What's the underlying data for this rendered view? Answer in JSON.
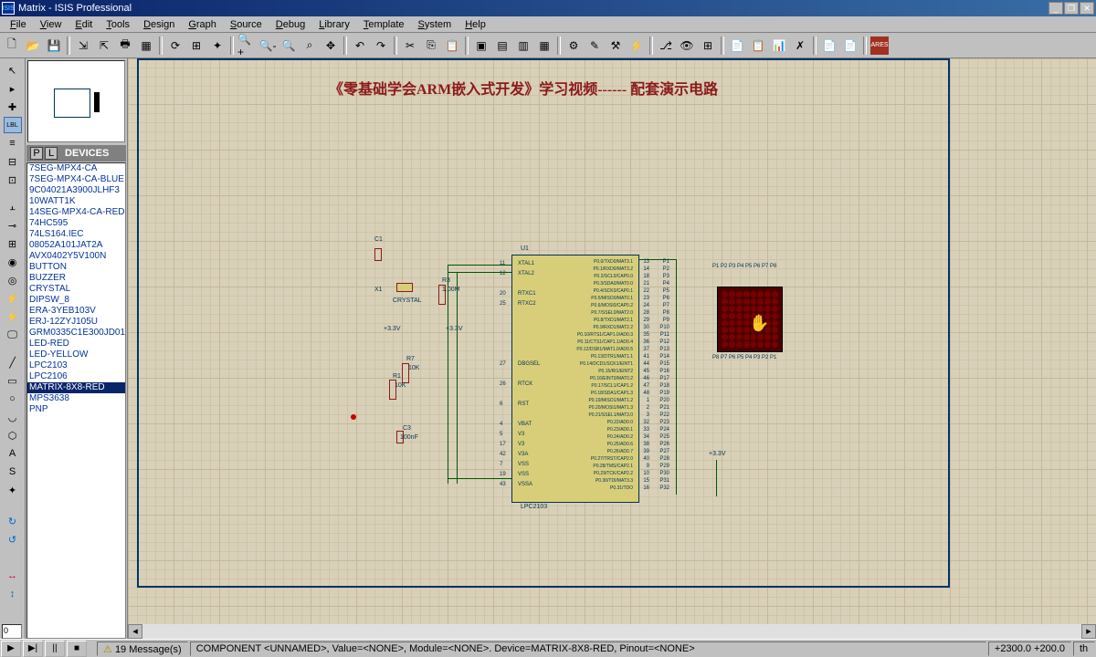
{
  "title": "Matrix - ISIS Professional",
  "menu": [
    "File",
    "View",
    "Edit",
    "Tools",
    "Design",
    "Graph",
    "Source",
    "Debug",
    "Library",
    "Template",
    "System",
    "Help"
  ],
  "heading": "《零基础学会ARM嵌入式开发》学习视频------ 配套演示电路",
  "devices_header": "DEVICES",
  "devices": [
    "7SEG-MPX4-CA",
    "7SEG-MPX4-CA-BLUE",
    "9C04021A3900JLHF3",
    "10WATT1K",
    "14SEG-MPX4-CA-RED",
    "74HC595",
    "74LS164.IEC",
    "08052A101JAT2A",
    "AVX0402Y5V100N",
    "BUTTON",
    "BUZZER",
    "CRYSTAL",
    "DIPSW_8",
    "ERA-3YEB103V",
    "ERJ-12ZYJ105U",
    "GRM0335C1E300JD01D",
    "LED-RED",
    "LED-YELLOW",
    "LPC2103",
    "LPC2106",
    "MATRIX-8X8-RED",
    "MPS3638",
    "PNP"
  ],
  "selected_device_index": 20,
  "ic_ref": "U1",
  "ic_part": "LPC2103",
  "left_pins": [
    "XTAL1",
    "XTAL2",
    "",
    "RTXC1",
    "RTXC2",
    "",
    "",
    "",
    "",
    "",
    "DBGSEL",
    "",
    "RTCK",
    "",
    "RST",
    "",
    "VBAT",
    "V3",
    "V3",
    "V3A",
    "VSS",
    "VSS",
    "VSSA"
  ],
  "left_pin_nums": [
    "11",
    "12",
    "",
    "20",
    "25",
    "",
    "",
    "",
    "",
    "",
    "27",
    "",
    "26",
    "",
    "6",
    "",
    "4",
    "5",
    "17",
    "42",
    "7",
    "19",
    "43"
  ],
  "right_pins": [
    "P0.0/TXD0/MAT3.1",
    "P0.1/RXD0/MAT3.2",
    "P0.2/SCL0/CAP0.0",
    "P0.3/SDA0/MAT0.0",
    "P0.4/SCK0/CAP0.1",
    "P0.5/MISO0/MAT0.1",
    "P0.6/MOSI0/CAP0.2",
    "P0.7/SSEL0/MAT2.0",
    "P0.8/TXD1/MAT2.1",
    "P0.9/RXD1/MAT2.2",
    "P0.10/RTS1/CAP1.0/AD0.3",
    "P0.11/CTS1/CAP1.1/AD0.4",
    "P0.12/DSR1/MAT1.0/AD0.5",
    "P0.13/DTR1/MAT1.1",
    "P0.14/DCD1/SCK1/EINT1",
    "P0.15/RI1/EINT2",
    "P0.16/EINT0/MAT0.2",
    "P0.17/SCL1/CAP1.2",
    "P0.18/SDA1/CAP1.3",
    "P0.19/MISO1/MAT1.2",
    "P0.20/MOSI1/MAT1.3",
    "P0.21/SSEL1/MAT3.0",
    "P0.22/AD0.0",
    "P0.23/AD0.1",
    "P0.24/AD0.2",
    "P0.25/AD0.6",
    "P0.26/AD0.7",
    "P0.27/TRST/CAP2.0",
    "P0.28/TMS/CAP2.1",
    "P0.29/TCK/CAP2.2",
    "P0.30/TDI/MAT3.3",
    "P0.31/TDO"
  ],
  "right_pin_nums": [
    "13",
    "14",
    "18",
    "21",
    "22",
    "23",
    "24",
    "28",
    "29",
    "30",
    "35",
    "36",
    "37",
    "41",
    "44",
    "45",
    "46",
    "47",
    "48",
    "1",
    "2",
    "3",
    "32",
    "33",
    "34",
    "38",
    "39",
    "40",
    "9",
    "10",
    "15",
    "16"
  ],
  "port_labels": [
    "P1",
    "P2",
    "P3",
    "P4",
    "P5",
    "P6",
    "P7",
    "P8",
    "P9",
    "P10",
    "P11",
    "P12",
    "P13",
    "P14",
    "P15",
    "P16",
    "P17",
    "P18",
    "P19",
    "P20",
    "P21",
    "P22",
    "P23",
    "P24",
    "P25",
    "P26",
    "P27",
    "P28",
    "P29",
    "P30",
    "P31",
    "P32"
  ],
  "components": {
    "C1": "C1",
    "X1": "X1",
    "crystal": "CRYSTAL",
    "R3": "R3",
    "r3val": "1.00M",
    "R7": "R7",
    "r7val": "10K",
    "R1": "R1",
    "r1val": "10K",
    "C3": "C3",
    "c3val": "100nF",
    "v33": "+3.3V",
    "v33_2": "+3.3V",
    "v33_3": "+3.3V"
  },
  "messages": "19 Message(s)",
  "status_main": "COMPONENT <UNNAMED>, Value=<NONE>, Module=<NONE>. Device=MATRIX-8X8-RED, Pinout=<NONE>",
  "coords": "+2300.0    +200.0",
  "coords_unit": "th",
  "coord_input": "0"
}
